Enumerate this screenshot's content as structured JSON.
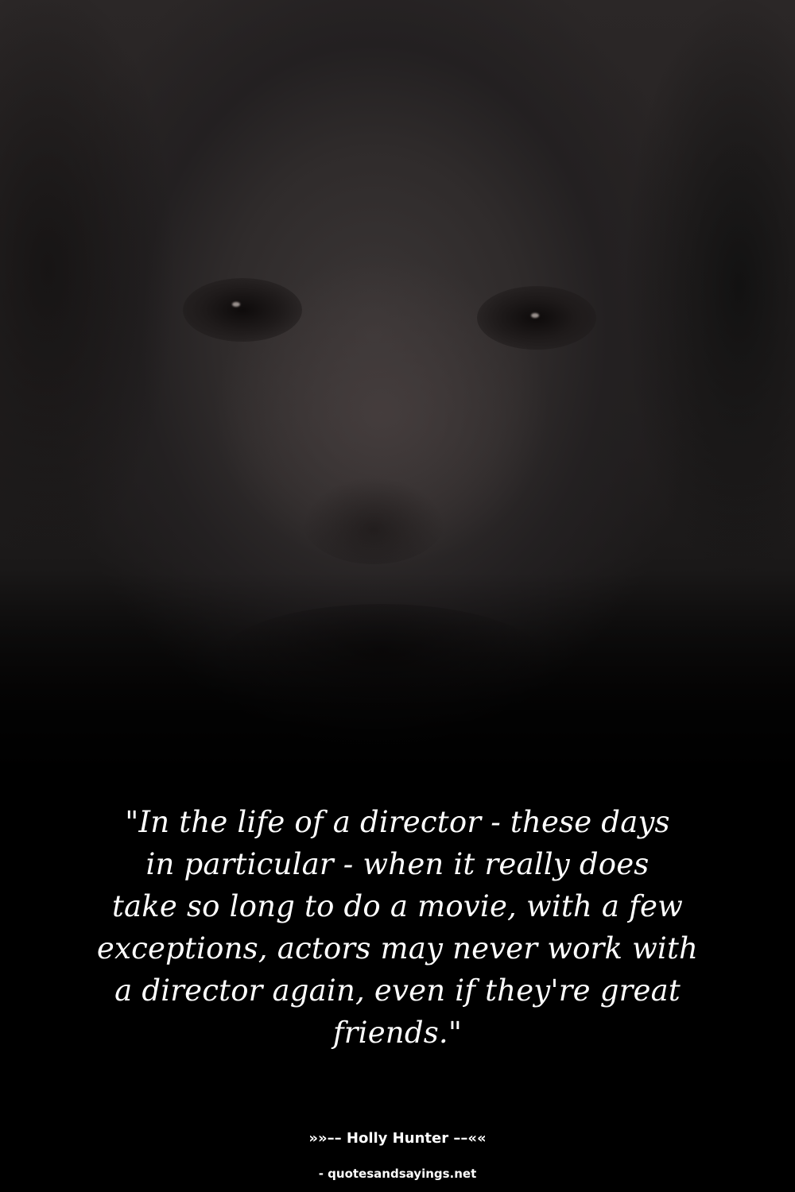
{
  "quote": {
    "lines": [
      "\"In the life of a director - these days",
      "in particular - when it really does",
      "take so long to do a movie, with a few",
      "exceptions, actors may never work with",
      "a director again, even if they're great",
      "friends.\""
    ]
  },
  "attribution": "»»–– Holly Hunter ––««",
  "source": "- quotesandsayings.net",
  "colors": {
    "background": "#000000",
    "text": "#ffffff"
  },
  "background_image": "dark blurred portrait of a smiling woman"
}
